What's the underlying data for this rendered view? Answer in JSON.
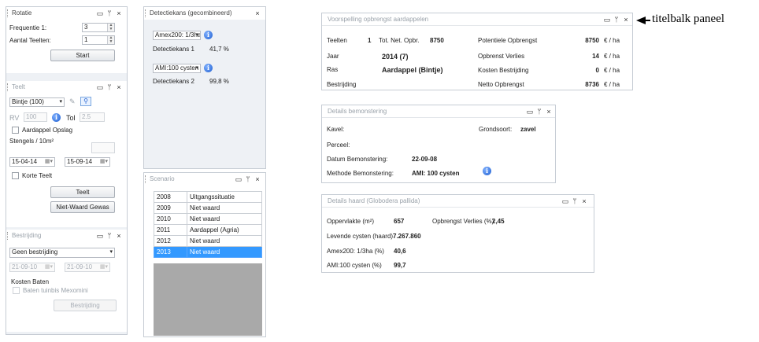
{
  "rotatie": {
    "title": "Rotatie",
    "frequentie_label": "Frequentie 1:",
    "frequentie_value": "3",
    "aantal_label": "Aantal Teelten:",
    "aantal_value": "1",
    "start_label": "Start"
  },
  "teelt": {
    "title": "Teelt",
    "ras_value": "Bintje (100)",
    "rv_label": "RV",
    "rv_value": "100",
    "tol_label": "Tol",
    "tol_value": "2.5",
    "opslag_label": "Aardappel Opslag",
    "stengels_label": "Stengels / 10m²",
    "date_start": "15-04-14",
    "date_end": "15-09-14",
    "korte_label": "Korte Teelt",
    "teelt_button": "Teelt",
    "netwaard_button": "Niet-Waard Gewas"
  },
  "bestrijding": {
    "title": "Bestrijding",
    "select_value": "Geen bestrijding",
    "date_start": "21-09-10",
    "date_end": "21-09-10",
    "kosten_label": "Kosten Baten",
    "baten_label": "Baten tuinbis Mexomini",
    "button_label": "Bestrijding"
  },
  "detectiekans": {
    "title": "Detectiekans (gecombineerd)",
    "select1": "Amex200: 1/3ha",
    "label1": "Detectiekans 1",
    "value1": "41,7 %",
    "select2": "AMI:100 cysten",
    "label2": "Detectiekans 2",
    "value2": "99,8 %"
  },
  "scenario": {
    "title": "Scenario",
    "rows": [
      {
        "year": "2008",
        "label": "Uitgangssituatie"
      },
      {
        "year": "2009",
        "label": "Niet waard"
      },
      {
        "year": "2010",
        "label": "Niet waard"
      },
      {
        "year": "2011",
        "label": "Aardappel (Agria)"
      },
      {
        "year": "2012",
        "label": "Niet waard"
      },
      {
        "year": "2013",
        "label": "Niet waard"
      }
    ]
  },
  "voorspelling": {
    "title": "Voorspelling opbrengst aardappelen",
    "teelten_label": "Teelten",
    "teelten_value": "1",
    "totnet_label": "Tot. Net. Opbr.",
    "totnet_value": "8750",
    "jaar_label": "Jaar",
    "jaar_value": "2014 (7)",
    "ras_label": "Ras",
    "ras_value": "Aardappel (Bintje)",
    "bestrijding_label": "Bestrijding",
    "pot_label": "Potentiele Opbrengst",
    "pot_value": "8750",
    "verlies_label": "Opbrenst Verlies",
    "verlies_value": "14",
    "kosten_label": "Kosten Bestrijding",
    "kosten_value": "0",
    "netto_label": "Netto Opbrengst",
    "netto_value": "8736",
    "unit": "€ / ha"
  },
  "bemonstering": {
    "title": "Details bemonstering",
    "kavel_label": "Kavel:",
    "perceel_label": "Perceel:",
    "datum_label": "Datum Bemonstering:",
    "datum_value": "22-09-08",
    "methode_label": "Methode Bemonstering:",
    "methode_value": "AMI: 100 cysten",
    "grondsoort_label": "Grondsoort:",
    "grondsoort_value": "zavel"
  },
  "haard": {
    "title": "Details haard (Globodera pallida)",
    "opp_label": "Oppervlakte (m²)",
    "opp_value": "657",
    "verlies_label": "Opbrengst Verlies (%)",
    "verlies_value": "2,45",
    "levende_label": "Levende cysten (haard)",
    "levende_value": "7.267.860",
    "amex_label": "Amex200: 1/3ha (%)",
    "amex_value": "40,6",
    "ami_label": "AMI:100 cysten (%)",
    "ami_value": "99,7"
  },
  "annotation": {
    "text": "titelbalk paneel"
  },
  "icons": {
    "restore": "▭",
    "pin": "ᛘ",
    "close": "×"
  }
}
